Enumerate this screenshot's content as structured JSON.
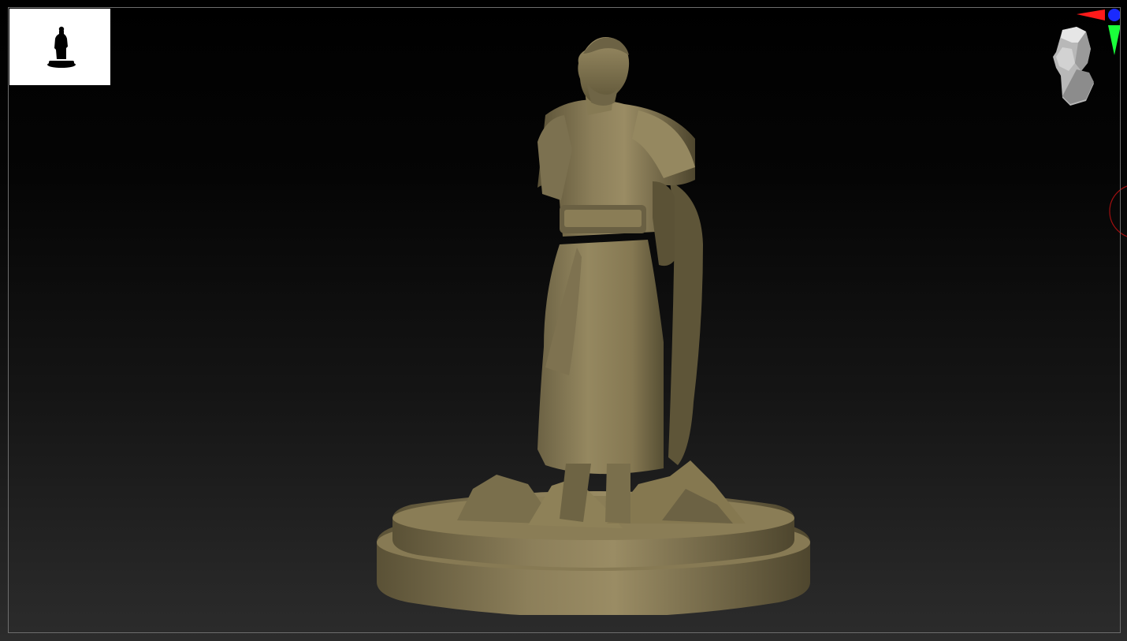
{
  "app": {
    "view": "3D viewport",
    "background_top": "#000000",
    "background_bottom": "#2c2c2c",
    "frame_color": "#6e6e6e"
  },
  "navigator": {
    "background": "#ffffff",
    "silhouette_icon": "figure-silhouette-icon"
  },
  "model": {
    "icon": "statue-model",
    "material_color": "#8a7c55"
  },
  "gizmo": {
    "icon": "orientation-head-icon",
    "x_axis_color": "#ff1a1a",
    "y_axis_color": "#1aff3a",
    "z_axis_color": "#1a2aff"
  },
  "edge_widget": {
    "icon": "rotation-circle-icon",
    "color": "#a01010"
  }
}
